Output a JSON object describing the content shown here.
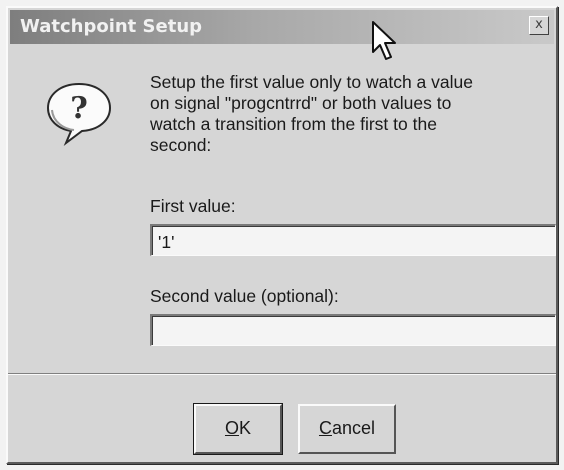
{
  "dialog": {
    "title": "Watchpoint Setup",
    "close_symbol": "x",
    "icon": "question-icon",
    "message": "Setup the first value only to watch a value\non signal \"progcntrrd\" or both values to\nwatch a transition from the first to the\nsecond:"
  },
  "fields": {
    "first": {
      "label": "First value:",
      "value": "'1'"
    },
    "second": {
      "label": "Second value (optional):",
      "value": ""
    }
  },
  "buttons": {
    "ok": {
      "mnemonic": "O",
      "rest": "K"
    },
    "cancel": {
      "mnemonic": "C",
      "rest": "ancel"
    }
  },
  "colors": {
    "face": "#d6d6d6",
    "titlebar_start": "#7e7e7e",
    "titlebar_end": "#c9c9c9"
  }
}
